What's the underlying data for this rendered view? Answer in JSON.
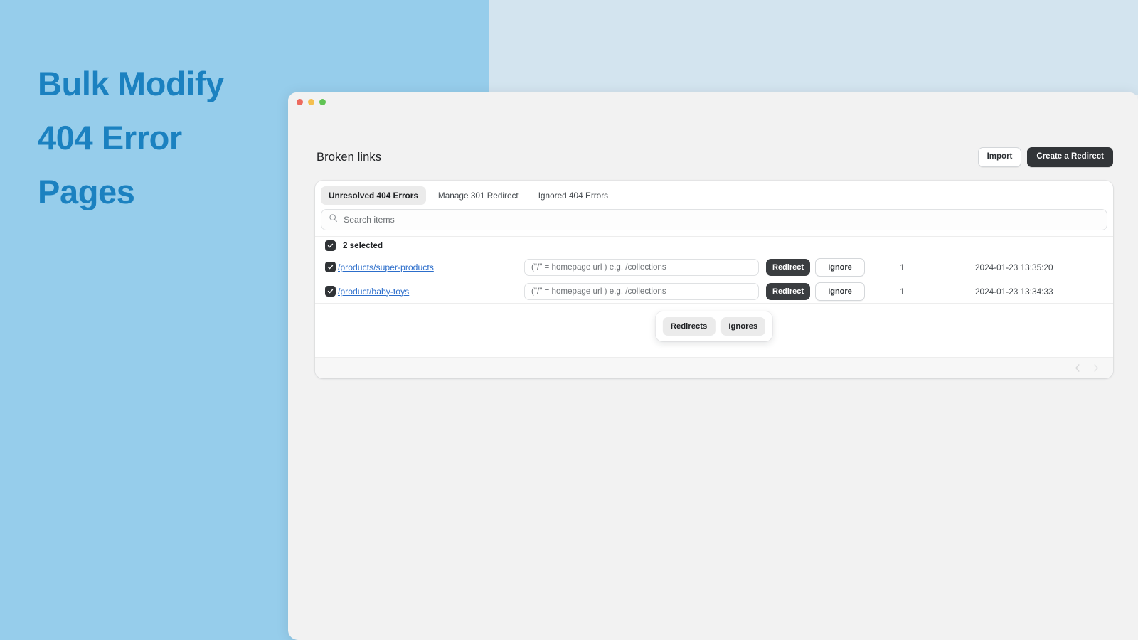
{
  "promo": {
    "headline_lines": [
      "Bulk Modify",
      "404 Error",
      "Pages"
    ],
    "band_color": "#96cdeb",
    "band_color_secondary": "#d3e4ef",
    "headline_color": "#1b81c0"
  },
  "window": {
    "traffic_lights": [
      "close-red",
      "minimize-yellow",
      "maximize-green"
    ]
  },
  "header": {
    "title": "Broken links",
    "import_label": "Import",
    "create_redirect_label": "Create a Redirect"
  },
  "tabs": [
    {
      "label": "Unresolved 404 Errors",
      "active": true
    },
    {
      "label": "Manage 301 Redirect",
      "active": false
    },
    {
      "label": "Ignored 404 Errors",
      "active": false
    }
  ],
  "search": {
    "value": "",
    "placeholder": "Search items",
    "icon": "search-icon"
  },
  "selection": {
    "label": "2 selected",
    "checked": true
  },
  "rows": [
    {
      "url": "/products/super-products",
      "checked": true,
      "target_value": "",
      "target_placeholder": "(\"/\" = homepage url ) e.g. /collections",
      "redirect_label": "Redirect",
      "ignore_label": "Ignore",
      "count": "1",
      "date": "2024-01-23 13:35:20"
    },
    {
      "url": "/product/baby-toys",
      "checked": true,
      "target_value": "",
      "target_placeholder": "(\"/\" = homepage url ) e.g. /collections",
      "redirect_label": "Redirect",
      "ignore_label": "Ignore",
      "count": "1",
      "date": "2024-01-23 13:34:33"
    }
  ],
  "bulk_actions": {
    "redirects_label": "Redirects",
    "ignores_label": "Ignores"
  },
  "pagination": {
    "prev_icon": "chevron-left-icon",
    "next_icon": "chevron-right-icon",
    "prev_enabled": false,
    "next_enabled": false
  },
  "colors": {
    "link": "#2c6ecb",
    "primary_button": "#323538",
    "accent": "#1b81c0"
  }
}
